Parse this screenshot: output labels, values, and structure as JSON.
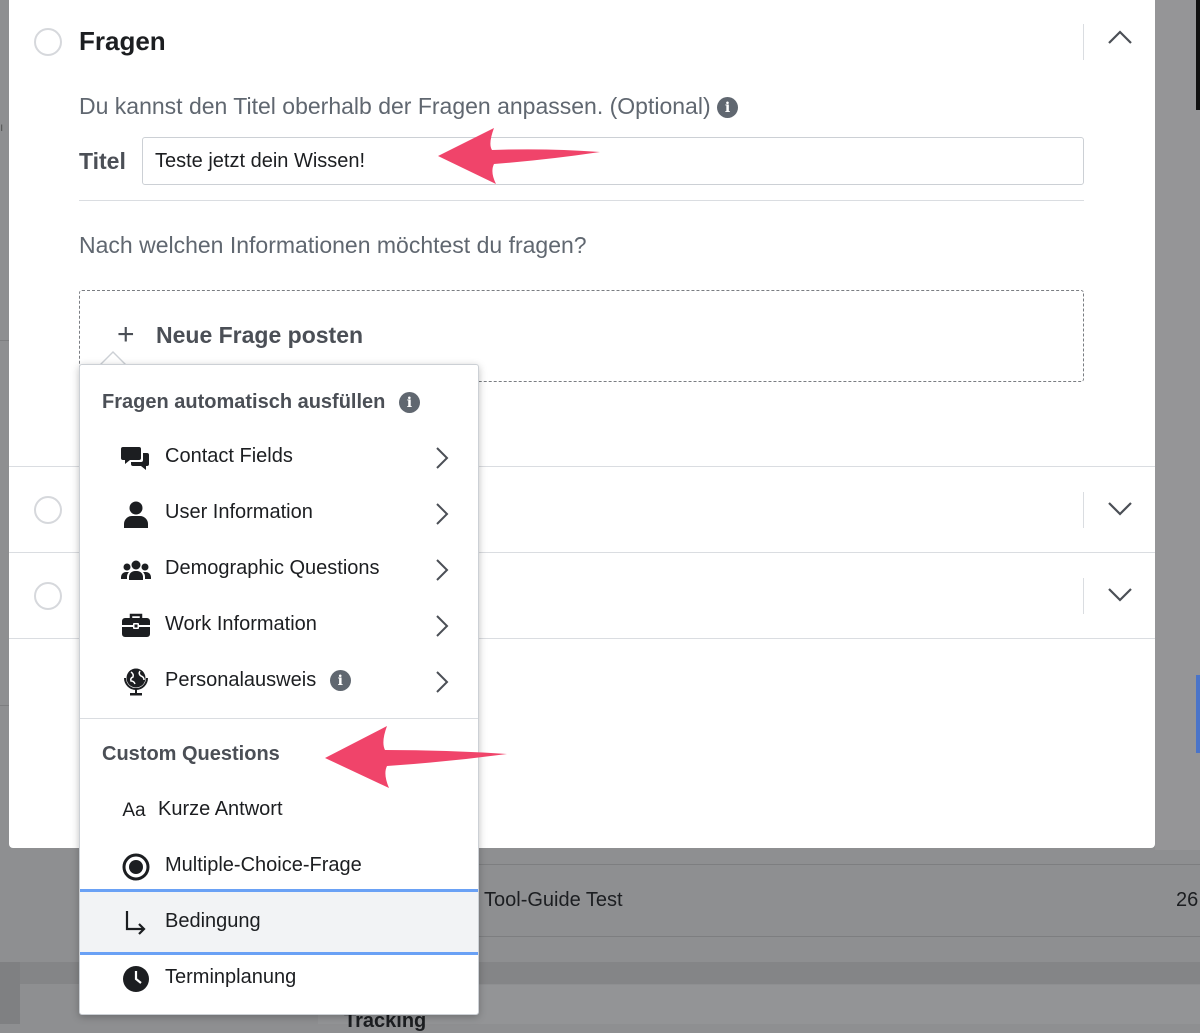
{
  "section_fragen": {
    "title": "Fragen",
    "description": "Du kannst den Titel oberhalb der Fragen anpassen. (Optional)",
    "titel_label": "Titel",
    "titel_value": "Teste jetzt dein Wissen!",
    "question_prompt": "Nach welchen Informationen möchtest du fragen?",
    "add_question_label": "Neue Frage posten"
  },
  "dropdown": {
    "autofill_heading": "Fragen automatisch ausfüllen",
    "autofill_items": [
      {
        "label": "Contact Fields",
        "icon": "chat-bubbles-icon"
      },
      {
        "label": "User Information",
        "icon": "user-icon"
      },
      {
        "label": "Demographic Questions",
        "icon": "group-icon"
      },
      {
        "label": "Work Information",
        "icon": "briefcase-icon"
      },
      {
        "label": "Personalausweis",
        "icon": "globe-icon"
      }
    ],
    "custom_heading": "Custom Questions",
    "custom_items": [
      {
        "label": "Kurze Antwort",
        "icon": "text-aa-icon",
        "icon_text": "Aa"
      },
      {
        "label": "Multiple-Choice-Frage",
        "icon": "radio-filled-icon"
      },
      {
        "label": "Bedingung",
        "icon": "branch-arrow-icon"
      },
      {
        "label": "Terminplanung",
        "icon": "clock-icon"
      }
    ]
  },
  "background": {
    "row_title": "Tool-Guide Test",
    "row_number": "26",
    "bottom_text": "Tracking"
  },
  "colors": {
    "annotation_arrow": "#f0446a",
    "selected_outline": "#6aa1f5",
    "overlay": "#8e8f91"
  }
}
